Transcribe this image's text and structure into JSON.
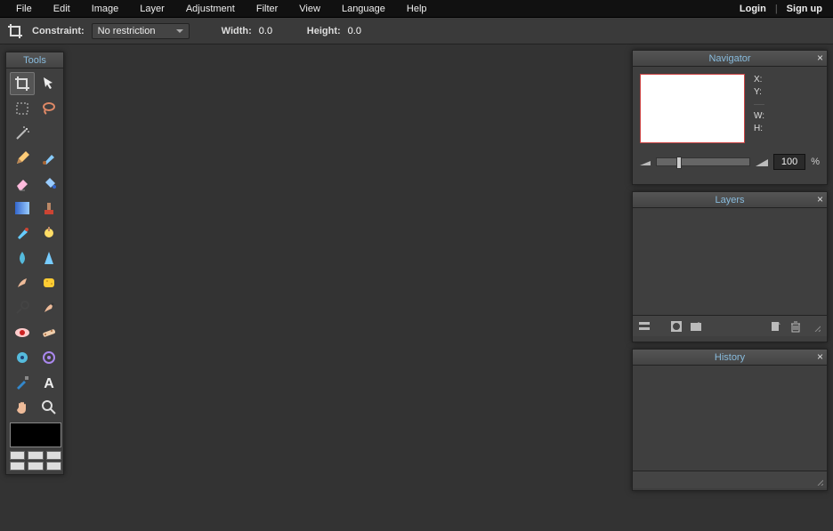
{
  "menu": {
    "file": "File",
    "edit": "Edit",
    "image": "Image",
    "layer": "Layer",
    "adjustment": "Adjustment",
    "filter": "Filter",
    "view": "View",
    "language": "Language",
    "help": "Help",
    "login": "Login",
    "signup": "Sign up"
  },
  "optbar": {
    "constraint_lbl": "Constraint:",
    "constraint_val": "No restriction",
    "width_lbl": "Width:",
    "width_val": "0.0",
    "height_lbl": "Height:",
    "height_val": "0.0"
  },
  "panels": {
    "tools": "Tools",
    "navigator": "Navigator",
    "layers": "Layers",
    "history": "History"
  },
  "nav": {
    "x": "X:",
    "y": "Y:",
    "w": "W:",
    "h": "H:",
    "zoom": "100",
    "pct": "%"
  }
}
